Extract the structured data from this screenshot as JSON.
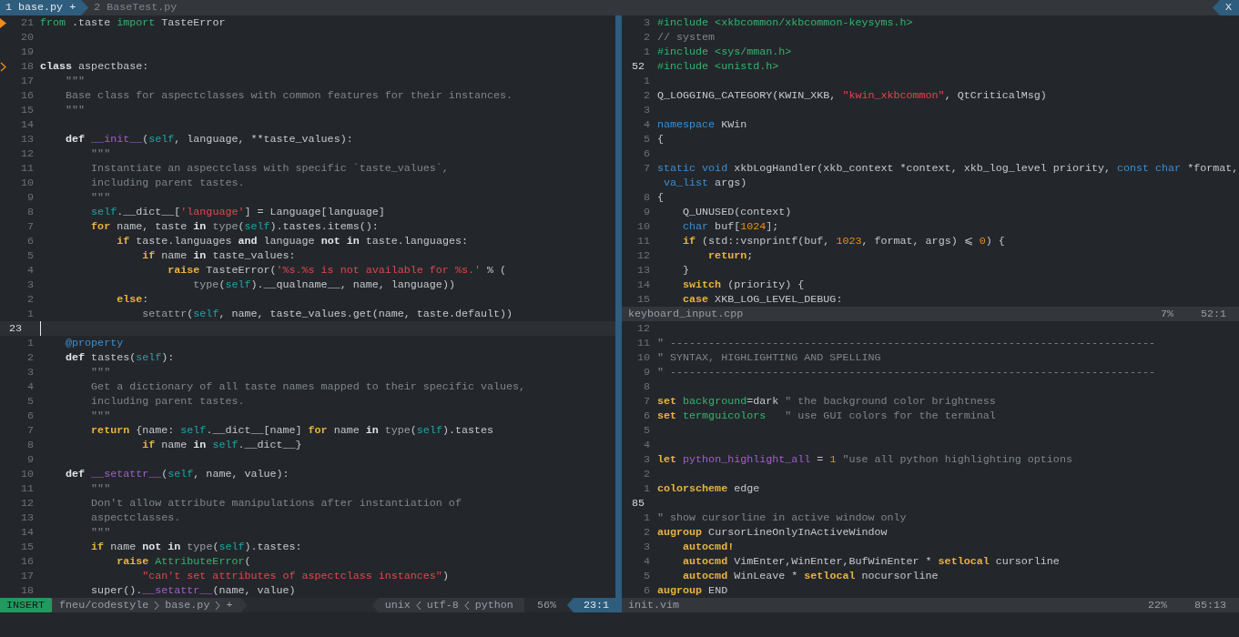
{
  "tabline": {
    "tabs": [
      {
        "label": "1 base.py +",
        "selected": true
      },
      {
        "label": "2 BaseTest.py",
        "selected": false
      }
    ],
    "close": "X"
  },
  "left_window": {
    "active": true,
    "lines": [
      {
        "number": "21",
        "current": false,
        "sign": {
          "kind": "triangle"
        },
        "tokens": [
          {
            "kind": "include",
            "text": "from"
          },
          {
            "kind": "plain",
            "text": " .taste "
          },
          {
            "kind": "include",
            "text": "import"
          },
          {
            "kind": "plain",
            "text": " TasteError"
          }
        ]
      },
      {
        "number": "20",
        "current": false
      },
      {
        "number": "19",
        "current": false
      },
      {
        "number": "18",
        "current": false,
        "sign": {
          "kind": "chevron"
        },
        "tokens": [
          {
            "kind": "statement",
            "text": "class"
          },
          {
            "kind": "plain",
            "text": " aspectbase:"
          }
        ]
      },
      {
        "number": "17",
        "current": false,
        "tokens": [
          {
            "kind": "comment",
            "text": "    \"\"\""
          }
        ]
      },
      {
        "number": "16",
        "current": false,
        "tokens": [
          {
            "kind": "comment",
            "text": "    Base class for aspectclasses with common features for their instances."
          }
        ]
      },
      {
        "number": "15",
        "current": false,
        "tokens": [
          {
            "kind": "comment",
            "text": "    \"\"\""
          }
        ]
      },
      {
        "number": "14",
        "current": false
      },
      {
        "number": "13",
        "current": false,
        "tokens": [
          {
            "kind": "statement",
            "text": "    def "
          },
          {
            "kind": "special",
            "text": "__init__"
          },
          {
            "kind": "plain",
            "text": "("
          },
          {
            "kind": "self",
            "text": "self"
          },
          {
            "kind": "plain",
            "text": ", language, **taste_values):"
          }
        ]
      },
      {
        "number": "12",
        "current": false,
        "tokens": [
          {
            "kind": "comment",
            "text": "        \"\"\""
          }
        ]
      },
      {
        "number": "11",
        "current": false,
        "tokens": [
          {
            "kind": "comment",
            "text": "        Instantiate an aspectclass with specific `taste_values`,"
          }
        ]
      },
      {
        "number": "10",
        "current": false,
        "tokens": [
          {
            "kind": "comment",
            "text": "        including parent tastes."
          }
        ]
      },
      {
        "number": "9",
        "current": false,
        "tokens": [
          {
            "kind": "comment",
            "text": "        \"\"\""
          }
        ]
      },
      {
        "number": "8",
        "current": false,
        "tokens": [
          {
            "kind": "self",
            "text": "        self"
          },
          {
            "kind": "plain",
            "text": ".__dict__["
          },
          {
            "kind": "string",
            "text": "'language'"
          },
          {
            "kind": "plain",
            "text": "] = Language[language]"
          }
        ]
      },
      {
        "number": "7",
        "current": false,
        "tokens": [
          {
            "kind": "keyword",
            "text": "        for"
          },
          {
            "kind": "plain",
            "text": " name, taste "
          },
          {
            "kind": "statement",
            "text": "in "
          },
          {
            "kind": "builtin",
            "text": "type"
          },
          {
            "kind": "plain",
            "text": "("
          },
          {
            "kind": "self",
            "text": "self"
          },
          {
            "kind": "plain",
            "text": ").tastes.items():"
          }
        ]
      },
      {
        "number": "6",
        "current": false,
        "tokens": [
          {
            "kind": "keyword",
            "text": "            if"
          },
          {
            "kind": "plain",
            "text": " taste.languages "
          },
          {
            "kind": "statement",
            "text": "and"
          },
          {
            "kind": "plain",
            "text": " language "
          },
          {
            "kind": "statement",
            "text": "not in"
          },
          {
            "kind": "plain",
            "text": " taste.languages:"
          }
        ]
      },
      {
        "number": "5",
        "current": false,
        "tokens": [
          {
            "kind": "keyword",
            "text": "                if"
          },
          {
            "kind": "plain",
            "text": " name "
          },
          {
            "kind": "statement",
            "text": "in"
          },
          {
            "kind": "plain",
            "text": " taste_values:"
          }
        ]
      },
      {
        "number": "4",
        "current": false,
        "tokens": [
          {
            "kind": "keyword",
            "text": "                    raise"
          },
          {
            "kind": "plain",
            "text": " TasteError("
          },
          {
            "kind": "string",
            "text": "'%s.%s is not available for %s.'"
          },
          {
            "kind": "plain",
            "text": " % ("
          }
        ]
      },
      {
        "number": "3",
        "current": false,
        "tokens": [
          {
            "kind": "builtin",
            "text": "                        type"
          },
          {
            "kind": "plain",
            "text": "("
          },
          {
            "kind": "self",
            "text": "self"
          },
          {
            "kind": "plain",
            "text": ").__qualname__, name, language))"
          }
        ]
      },
      {
        "number": "2",
        "current": false,
        "tokens": [
          {
            "kind": "keyword",
            "text": "            else"
          },
          {
            "kind": "plain",
            "text": ":"
          }
        ]
      },
      {
        "number": "1",
        "current": false,
        "tokens": [
          {
            "kind": "builtin",
            "text": "                setattr"
          },
          {
            "kind": "plain",
            "text": "("
          },
          {
            "kind": "self",
            "text": "self"
          },
          {
            "kind": "plain",
            "text": ", name, taste_values.get(name, taste.default))"
          }
        ]
      },
      {
        "number": "23",
        "current": true
      },
      {
        "number": "1",
        "current": false,
        "tokens": [
          {
            "kind": "type",
            "text": "    @property"
          }
        ]
      },
      {
        "number": "2",
        "current": false,
        "tokens": [
          {
            "kind": "statement",
            "text": "    def"
          },
          {
            "kind": "plain",
            "text": " tastes("
          },
          {
            "kind": "self",
            "text": "self"
          },
          {
            "kind": "plain",
            "text": "):"
          }
        ]
      },
      {
        "number": "3",
        "current": false,
        "tokens": [
          {
            "kind": "comment",
            "text": "        \"\"\""
          }
        ]
      },
      {
        "number": "4",
        "current": false,
        "tokens": [
          {
            "kind": "comment",
            "text": "        Get a dictionary of all taste names mapped to their specific values,"
          }
        ]
      },
      {
        "number": "5",
        "current": false,
        "tokens": [
          {
            "kind": "comment",
            "text": "        including parent tastes."
          }
        ]
      },
      {
        "number": "6",
        "current": false,
        "tokens": [
          {
            "kind": "comment",
            "text": "        \"\"\""
          }
        ]
      },
      {
        "number": "7",
        "current": false,
        "tokens": [
          {
            "kind": "keyword",
            "text": "        return"
          },
          {
            "kind": "plain",
            "text": " {name: "
          },
          {
            "kind": "self",
            "text": "self"
          },
          {
            "kind": "plain",
            "text": ".__dict__[name] "
          },
          {
            "kind": "keyword",
            "text": "for"
          },
          {
            "kind": "plain",
            "text": " name "
          },
          {
            "kind": "statement",
            "text": "in "
          },
          {
            "kind": "builtin",
            "text": "type"
          },
          {
            "kind": "plain",
            "text": "("
          },
          {
            "kind": "self",
            "text": "self"
          },
          {
            "kind": "plain",
            "text": ").tastes"
          }
        ]
      },
      {
        "number": "8",
        "current": false,
        "tokens": [
          {
            "kind": "keyword",
            "text": "                if"
          },
          {
            "kind": "plain",
            "text": " name "
          },
          {
            "kind": "statement",
            "text": "in "
          },
          {
            "kind": "self",
            "text": "self"
          },
          {
            "kind": "plain",
            "text": ".__dict__}"
          }
        ]
      },
      {
        "number": "9",
        "current": false
      },
      {
        "number": "10",
        "current": false,
        "tokens": [
          {
            "kind": "statement",
            "text": "    def "
          },
          {
            "kind": "special",
            "text": "__setattr__"
          },
          {
            "kind": "plain",
            "text": "("
          },
          {
            "kind": "self",
            "text": "self"
          },
          {
            "kind": "plain",
            "text": ", name, value):"
          }
        ]
      },
      {
        "number": "11",
        "current": false,
        "tokens": [
          {
            "kind": "comment",
            "text": "        \"\"\""
          }
        ]
      },
      {
        "number": "12",
        "current": false,
        "tokens": [
          {
            "kind": "comment",
            "text": "        Don't allow attribute manipulations after instantiation of"
          }
        ]
      },
      {
        "number": "13",
        "current": false,
        "tokens": [
          {
            "kind": "comment",
            "text": "        aspectclasses."
          }
        ]
      },
      {
        "number": "14",
        "current": false,
        "tokens": [
          {
            "kind": "comment",
            "text": "        \"\"\""
          }
        ]
      },
      {
        "number": "15",
        "current": false,
        "tokens": [
          {
            "kind": "keyword",
            "text": "        if"
          },
          {
            "kind": "plain",
            "text": " name "
          },
          {
            "kind": "statement",
            "text": "not in "
          },
          {
            "kind": "builtin",
            "text": "type"
          },
          {
            "kind": "plain",
            "text": "("
          },
          {
            "kind": "self",
            "text": "self"
          },
          {
            "kind": "plain",
            "text": ").tastes:"
          }
        ]
      },
      {
        "number": "16",
        "current": false,
        "tokens": [
          {
            "kind": "keyword",
            "text": "            raise "
          },
          {
            "kind": "include",
            "text": "AttributeError"
          },
          {
            "kind": "plain",
            "text": "("
          }
        ]
      },
      {
        "number": "17",
        "current": false,
        "tokens": [
          {
            "kind": "string",
            "text": "                \"can't set attributes of aspectclass instances\""
          },
          {
            "kind": "plain",
            "text": ")"
          }
        ]
      },
      {
        "number": "18",
        "current": false,
        "tokens": [
          {
            "kind": "plain",
            "text": "        super()."
          },
          {
            "kind": "special",
            "text": "__setattr__"
          },
          {
            "kind": "plain",
            "text": "(name, value)"
          }
        ]
      }
    ],
    "statusline": {
      "mode": "INSERT",
      "path": [
        "fneu/codestyle",
        "base.py",
        "+"
      ],
      "fileinfo": [
        "unix",
        "utf-8",
        "python"
      ],
      "percent": "56%",
      "position": "23:1"
    }
  },
  "right_top_window": {
    "active": false,
    "lines": [
      {
        "number": "3",
        "current": false,
        "tokens": [
          {
            "kind": "include",
            "text": "#include <xkbcommon/xkbcommon-keysyms.h>"
          }
        ]
      },
      {
        "number": "2",
        "current": false,
        "tokens": [
          {
            "kind": "comment",
            "text": "// system"
          }
        ]
      },
      {
        "number": "1",
        "current": false,
        "tokens": [
          {
            "kind": "include",
            "text": "#include <sys/mman.h>"
          }
        ]
      },
      {
        "number": "52",
        "current": true,
        "tokens": [
          {
            "kind": "include",
            "text": "#include <unistd.h>"
          }
        ]
      },
      {
        "number": "1",
        "current": false
      },
      {
        "number": "2",
        "current": false,
        "tokens": [
          {
            "kind": "plain",
            "text": "Q_LOGGING_CATEGORY(KWIN_XKB, "
          },
          {
            "kind": "string",
            "text": "\"kwin_xkbcommon\""
          },
          {
            "kind": "plain",
            "text": ", QtCriticalMsg)"
          }
        ]
      },
      {
        "number": "3",
        "current": false
      },
      {
        "number": "4",
        "current": false,
        "tokens": [
          {
            "kind": "type",
            "text": "namespace"
          },
          {
            "kind": "plain",
            "text": " KWin"
          }
        ]
      },
      {
        "number": "5",
        "current": false,
        "tokens": [
          {
            "kind": "plain",
            "text": "{"
          }
        ]
      },
      {
        "number": "6",
        "current": false
      },
      {
        "number": "7",
        "current": false,
        "tokens": [
          {
            "kind": "type",
            "text": "static void"
          },
          {
            "kind": "plain",
            "text": " xkbLogHandler(xkb_context *context, xkb_log_level priority, "
          },
          {
            "kind": "type",
            "text": "const char"
          },
          {
            "kind": "plain",
            "text": " *format,"
          }
        ]
      },
      {
        "tokens": [
          {
            "kind": "type",
            "text": " va_list"
          },
          {
            "kind": "plain",
            "text": " args)"
          }
        ]
      },
      {
        "number": "8",
        "current": false,
        "tokens": [
          {
            "kind": "plain",
            "text": "{"
          }
        ]
      },
      {
        "number": "9",
        "current": false,
        "tokens": [
          {
            "kind": "plain",
            "text": "    Q_UNUSED(context)"
          }
        ]
      },
      {
        "number": "10",
        "current": false,
        "tokens": [
          {
            "kind": "type",
            "text": "    char"
          },
          {
            "kind": "plain",
            "text": " buf["
          },
          {
            "kind": "number",
            "text": "1024"
          },
          {
            "kind": "plain",
            "text": "];"
          }
        ]
      },
      {
        "number": "11",
        "current": false,
        "tokens": [
          {
            "kind": "keyword",
            "text": "    if"
          },
          {
            "kind": "plain",
            "text": " (std::vsnprintf(buf, "
          },
          {
            "kind": "number",
            "text": "1023"
          },
          {
            "kind": "plain",
            "text": ", format, args) ⩽ "
          },
          {
            "kind": "number",
            "text": "0"
          },
          {
            "kind": "plain",
            "text": ") {"
          }
        ]
      },
      {
        "number": "12",
        "current": false,
        "tokens": [
          {
            "kind": "keyword",
            "text": "        return"
          },
          {
            "kind": "plain",
            "text": ";"
          }
        ]
      },
      {
        "number": "13",
        "current": false,
        "tokens": [
          {
            "kind": "plain",
            "text": "    }"
          }
        ]
      },
      {
        "number": "14",
        "current": false,
        "tokens": [
          {
            "kind": "keyword",
            "text": "    switch"
          },
          {
            "kind": "plain",
            "text": " (priority) {"
          }
        ]
      },
      {
        "number": "15",
        "current": false,
        "tokens": [
          {
            "kind": "keyword",
            "text": "    case"
          },
          {
            "kind": "plain",
            "text": " XKB_LOG_LEVEL_DEBUG:"
          }
        ]
      }
    ],
    "statusline": {
      "file": "keyboard_input.cpp",
      "percent": "7%",
      "position": "52:1"
    }
  },
  "right_bottom_window": {
    "active": false,
    "lines": [
      {
        "number": "12",
        "current": false
      },
      {
        "number": "11",
        "current": false,
        "tokens": [
          {
            "kind": "comment",
            "text": "\" ----------------------------------------------------------------------------"
          }
        ]
      },
      {
        "number": "10",
        "current": false,
        "tokens": [
          {
            "kind": "comment",
            "text": "\" SYNTAX, HIGHLIGHTING AND SPELLING"
          }
        ]
      },
      {
        "number": "9",
        "current": false,
        "tokens": [
          {
            "kind": "comment",
            "text": "\" ----------------------------------------------------------------------------"
          }
        ]
      },
      {
        "number": "8",
        "current": false
      },
      {
        "number": "7",
        "current": false,
        "tokens": [
          {
            "kind": "keyword",
            "text": "set "
          },
          {
            "kind": "include",
            "text": "background"
          },
          {
            "kind": "plain",
            "text": "=dark "
          },
          {
            "kind": "comment",
            "text": "\" the background color brightness"
          }
        ]
      },
      {
        "number": "6",
        "current": false,
        "tokens": [
          {
            "kind": "keyword",
            "text": "set "
          },
          {
            "kind": "include",
            "text": "termguicolors"
          },
          {
            "kind": "comment",
            "text": "   \" use GUI colors for the terminal"
          }
        ]
      },
      {
        "number": "5",
        "current": false
      },
      {
        "number": "4",
        "current": false
      },
      {
        "number": "3",
        "current": false,
        "tokens": [
          {
            "kind": "keyword",
            "text": "let "
          },
          {
            "kind": "special",
            "text": "python_highlight_all"
          },
          {
            "kind": "plain",
            "text": " = "
          },
          {
            "kind": "number",
            "text": "1"
          },
          {
            "kind": "comment",
            "text": " \"use all python highlighting options"
          }
        ]
      },
      {
        "number": "2",
        "current": false
      },
      {
        "number": "1",
        "current": false,
        "tokens": [
          {
            "kind": "keyword",
            "text": "colorscheme"
          },
          {
            "kind": "plain",
            "text": " edge"
          }
        ]
      },
      {
        "number": "85",
        "current": true
      },
      {
        "number": "1",
        "current": false,
        "tokens": [
          {
            "kind": "comment",
            "text": "\" show cursorline in active window only"
          }
        ]
      },
      {
        "number": "2",
        "current": false,
        "tokens": [
          {
            "kind": "keyword",
            "text": "augroup"
          },
          {
            "kind": "plain",
            "text": " CursorLineOnlyInActiveWindow"
          }
        ]
      },
      {
        "number": "3",
        "current": false,
        "tokens": [
          {
            "kind": "keyword",
            "text": "    autocmd!"
          }
        ]
      },
      {
        "number": "4",
        "current": false,
        "tokens": [
          {
            "kind": "keyword",
            "text": "    autocmd"
          },
          {
            "kind": "plain",
            "text": " VimEnter,WinEnter,BufWinEnter * "
          },
          {
            "kind": "keyword",
            "text": "setlocal"
          },
          {
            "kind": "plain",
            "text": " cursorline"
          }
        ]
      },
      {
        "number": "5",
        "current": false,
        "tokens": [
          {
            "kind": "keyword",
            "text": "    autocmd"
          },
          {
            "kind": "plain",
            "text": " WinLeave * "
          },
          {
            "kind": "keyword",
            "text": "setlocal"
          },
          {
            "kind": "plain",
            "text": " nocursorline"
          }
        ]
      },
      {
        "number": "6",
        "current": false,
        "tokens": [
          {
            "kind": "keyword",
            "text": "augroup"
          },
          {
            "kind": "plain",
            "text": " END"
          }
        ]
      }
    ],
    "statusline": {
      "file": "init.vim",
      "percent": "22%",
      "position": "85:13"
    }
  }
}
